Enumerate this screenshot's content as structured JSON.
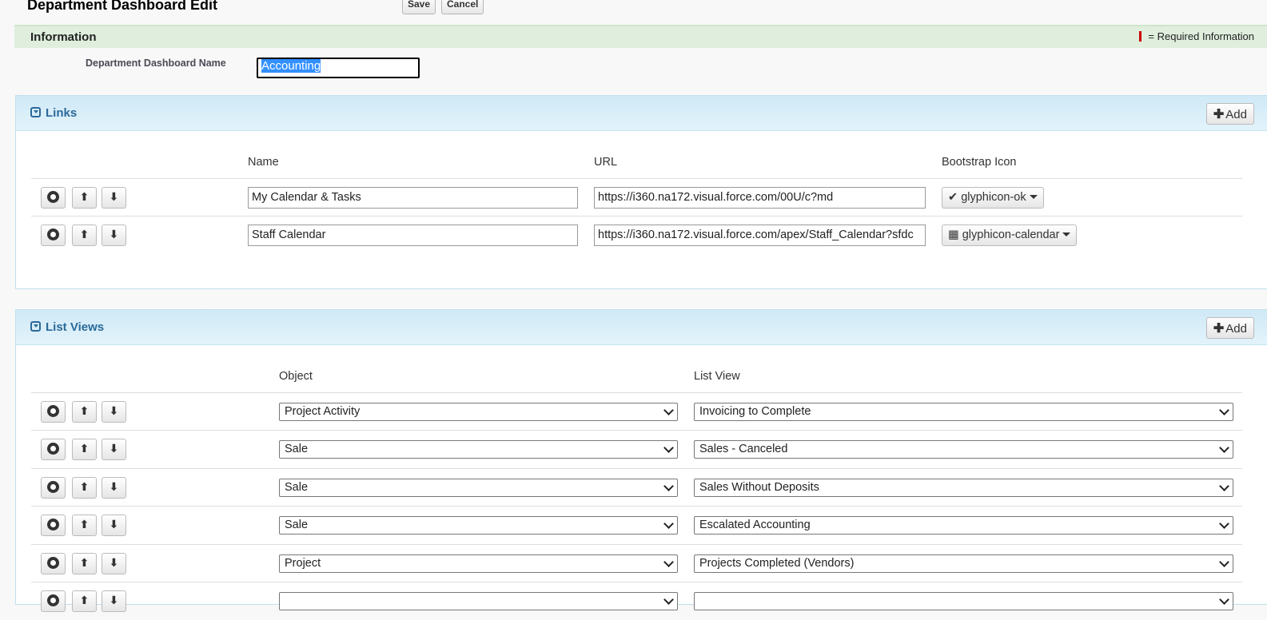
{
  "header": {
    "title": "Department Dashboard Edit",
    "save_label": "Save",
    "cancel_label": "Cancel"
  },
  "information": {
    "section_title": "Information",
    "required_legend": "= Required Information",
    "name_label": "Department Dashboard Name",
    "name_value": "Accounting"
  },
  "links": {
    "title": "Links",
    "add_label": "Add",
    "columns": {
      "name": "Name",
      "url": "URL",
      "icon": "Bootstrap Icon"
    },
    "rows": [
      {
        "name": "My Calendar & Tasks",
        "url": "https://i360.na172.visual.force.com/00U/c?md",
        "icon": "glyphicon-ok",
        "icon_glyph": "✔"
      },
      {
        "name": "Staff Calendar",
        "url": "https://i360.na172.visual.force.com/apex/Staff_Calendar?sfdc",
        "icon": "glyphicon-calendar",
        "icon_glyph": "▦"
      }
    ]
  },
  "list_views": {
    "title": "List Views",
    "add_label": "Add",
    "columns": {
      "object": "Object",
      "list_view": "List View"
    },
    "rows": [
      {
        "object": "Project Activity",
        "list_view": "Invoicing to Complete"
      },
      {
        "object": "Sale",
        "list_view": "Sales - Canceled"
      },
      {
        "object": "Sale",
        "list_view": "Sales Without Deposits"
      },
      {
        "object": "Sale",
        "list_view": "Escalated Accounting"
      },
      {
        "object": "Project",
        "list_view": "Projects Completed (Vendors)"
      },
      {
        "object": "",
        "list_view": ""
      }
    ]
  },
  "icons": {
    "remove": "remove-circle-icon",
    "up": "arrow-up-icon",
    "down": "arrow-down-icon",
    "collapse": "collapse-down-icon",
    "plus": "plus-icon"
  },
  "colors": {
    "info_header": "#dfeedd",
    "panel_header": "#cfe9f6",
    "panel_title": "#2a6a9a",
    "required": "#cc0000",
    "selection": "#3390ff"
  }
}
